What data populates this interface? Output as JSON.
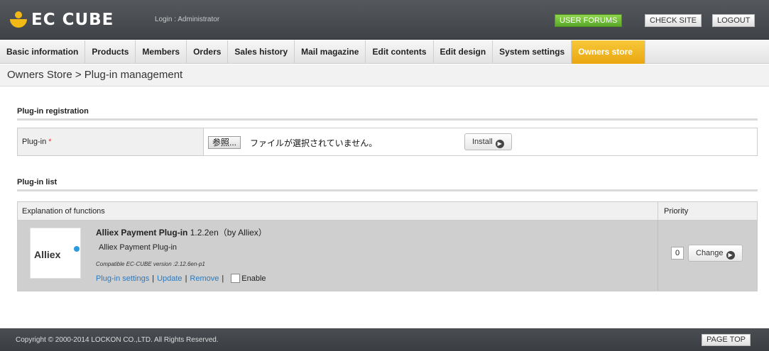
{
  "header": {
    "logo_text": "EC CUBE",
    "login_info": "Login : Administrator",
    "buttons": {
      "forums": "USER FORUMS",
      "check_site": "CHECK SITE",
      "logout": "LOGOUT"
    }
  },
  "nav": {
    "items": [
      {
        "label": "Basic information"
      },
      {
        "label": "Products"
      },
      {
        "label": "Members"
      },
      {
        "label": "Orders"
      },
      {
        "label": "Sales history"
      },
      {
        "label": "Mail magazine"
      },
      {
        "label": "Edit contents"
      },
      {
        "label": "Edit design"
      },
      {
        "label": "System settings"
      },
      {
        "label": "Owners store",
        "active": true
      }
    ]
  },
  "breadcrumb": "Owners Store > Plug-in management",
  "registration": {
    "title": "Plug-in registration",
    "field_label": "Plug-in",
    "required_mark": "*",
    "file_button": "参照...",
    "file_status": "ファイルが選択されていません。",
    "install_label": "Install"
  },
  "plugin_list": {
    "title": "Plug-in list",
    "columns": {
      "explanation": "Explanation of functions",
      "priority": "Priority"
    },
    "rows": [
      {
        "logo_text": "Alliex",
        "name": "Alliex Payment Plug-in",
        "version_author": "1.2.2en（by Alliex）",
        "description": "Alliex Payment Plug-in",
        "compatibility": "Compatible EC-CUBE version :2.12.6en-p1",
        "links": {
          "settings": "Plug-in settings",
          "update": "Update",
          "remove": "Remove"
        },
        "enable_label": "Enable",
        "priority": "0",
        "change_label": "Change"
      }
    ]
  },
  "footer": {
    "copyright": "Copyright © 2000-2014 LOCKON CO.,LTD. All Rights Reserved.",
    "page_top": "PAGE TOP"
  },
  "colors": {
    "accent": "#eaa710",
    "forums": "#5aa82a",
    "link": "#2a7ac0"
  }
}
